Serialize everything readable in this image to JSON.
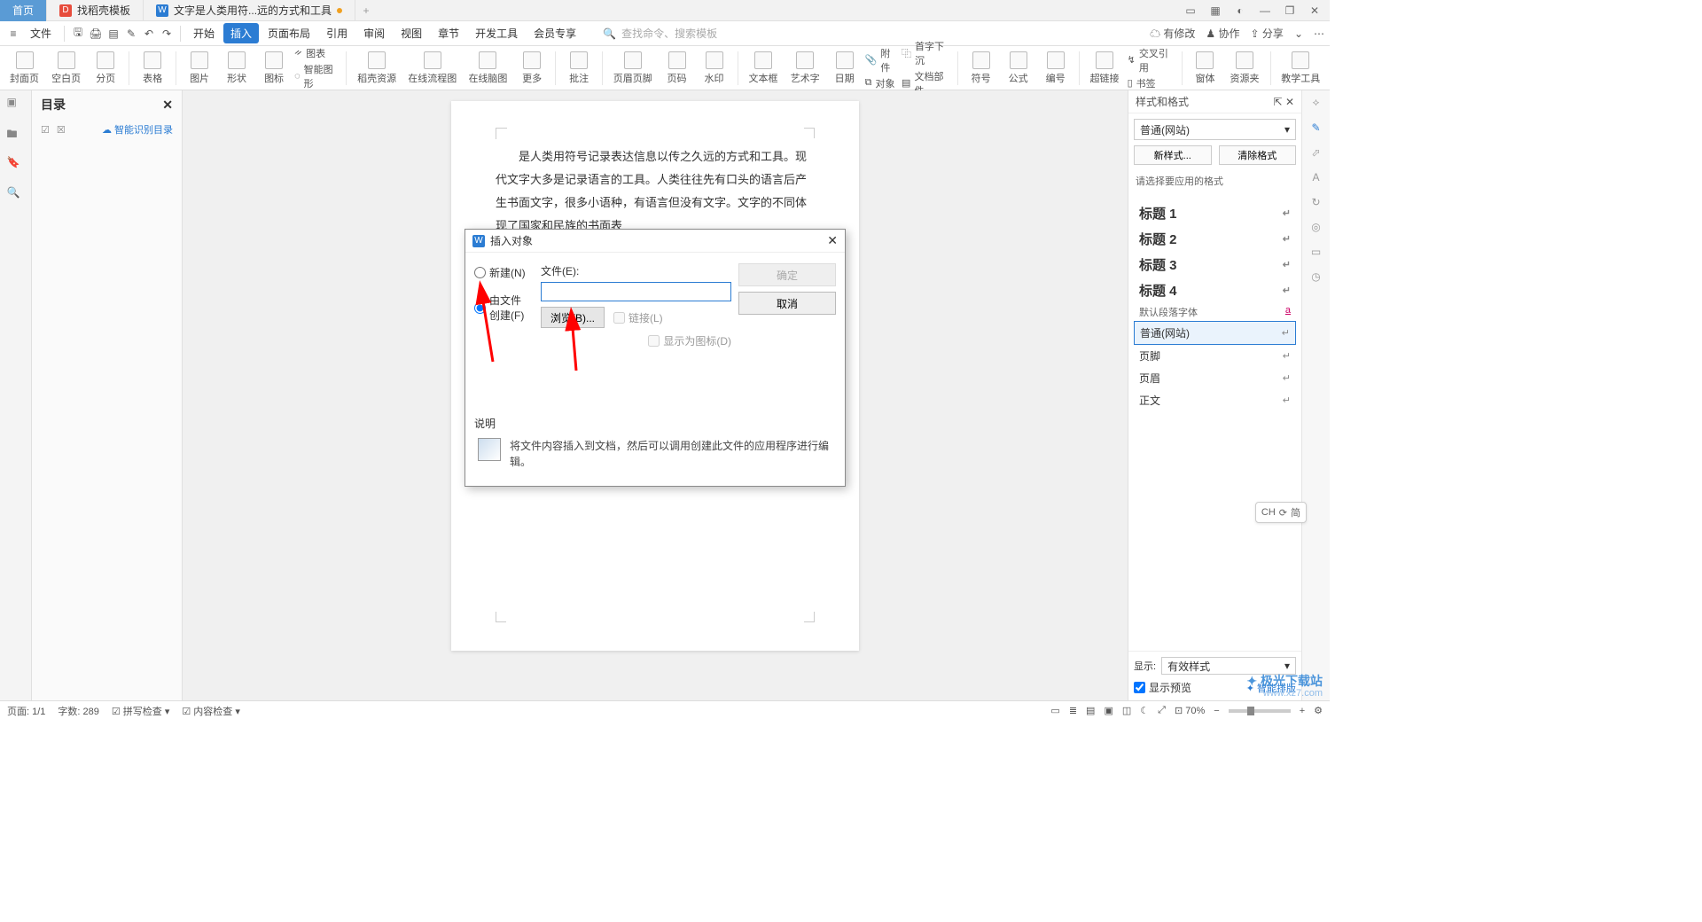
{
  "titlebar": {
    "tab_home": "首页",
    "tab_template": "找稻壳模板",
    "tab_doc": "文字是人类用符...远的方式和工具"
  },
  "menubar": {
    "file": "文件",
    "items": [
      "开始",
      "插入",
      "页面布局",
      "引用",
      "审阅",
      "视图",
      "章节",
      "开发工具",
      "会员专享"
    ],
    "active_index": 1,
    "search_cmd": "查找命令、搜索模板",
    "right": {
      "youxiu": "有修改",
      "xiezuo": "协作",
      "fenxiang": "分享"
    }
  },
  "ribbon": {
    "items": [
      "封面页",
      "空白页",
      "分页",
      "表格",
      "图片",
      "形状",
      "图标",
      "图表",
      "智能图形",
      "稻壳资源",
      "在线流程图",
      "在线脑图",
      "更多",
      "批注",
      "页眉页脚",
      "页码",
      "水印",
      "文本框",
      "艺术字",
      "日期",
      "附件",
      "对象",
      "文档部件",
      "符号",
      "公式",
      "编号",
      "超链接",
      "交叉引用",
      "书签",
      "窗体",
      "资源夹",
      "教学工具"
    ],
    "smart": "智能图形",
    "chart_small": "图表",
    "duixiang": "对象",
    "wendang": "文档部件",
    "shouzi": "首字下沉",
    "jiaocha": "交叉引用",
    "shuqian": "书签"
  },
  "sidebar": {
    "title": "目录",
    "smart": "智能识别目录"
  },
  "doc": {
    "para": "是人类用符号记录表达信息以传之久远的方式和工具。现代文字大多是记录语言的工具。人类往往先有口头的语言后产生书面文字，很多小语种，有语言但没有文字。文字的不同体现了国家和民族的书面表"
  },
  "dialog": {
    "title": "插入对象",
    "radio_new": "新建(N)",
    "radio_file": "由文件创建(F)",
    "file_label": "文件(E):",
    "browse": "浏览(B)...",
    "link": "链接(L)",
    "show_icon": "显示为图标(D)",
    "ok": "确定",
    "cancel": "取消",
    "desc_head": "说明",
    "desc_text": "将文件内容插入到文档，然后可以调用创建此文件的应用程序进行编辑。"
  },
  "right_panel": {
    "title": "样式和格式",
    "current": "普通(网站)",
    "new_style": "新样式...",
    "clear": "清除格式",
    "hint": "请选择要应用的格式",
    "styles": [
      {
        "label": "标题 1",
        "cls": "h"
      },
      {
        "label": "标题 2",
        "cls": "h"
      },
      {
        "label": "标题 3",
        "cls": "h"
      },
      {
        "label": "标题 4",
        "cls": "h"
      }
    ],
    "default_para": "默认段落字体",
    "putong": "普通(网站)",
    "yejiao": "页脚",
    "yemei": "页眉",
    "zhengwen": "正文",
    "show_label": "显示:",
    "show_value": "有效样式",
    "preview": "显示预览",
    "smart_layout": "智能排版"
  },
  "status": {
    "page": "页面: 1/1",
    "words": "字数: 289",
    "spell": "拼写检查",
    "content": "内容检查",
    "zoom": "70%"
  },
  "ime": {
    "ch": "CH",
    "pin": "简"
  },
  "watermark": {
    "line1": "极光下载站",
    "line2": "www.xz7.com"
  }
}
